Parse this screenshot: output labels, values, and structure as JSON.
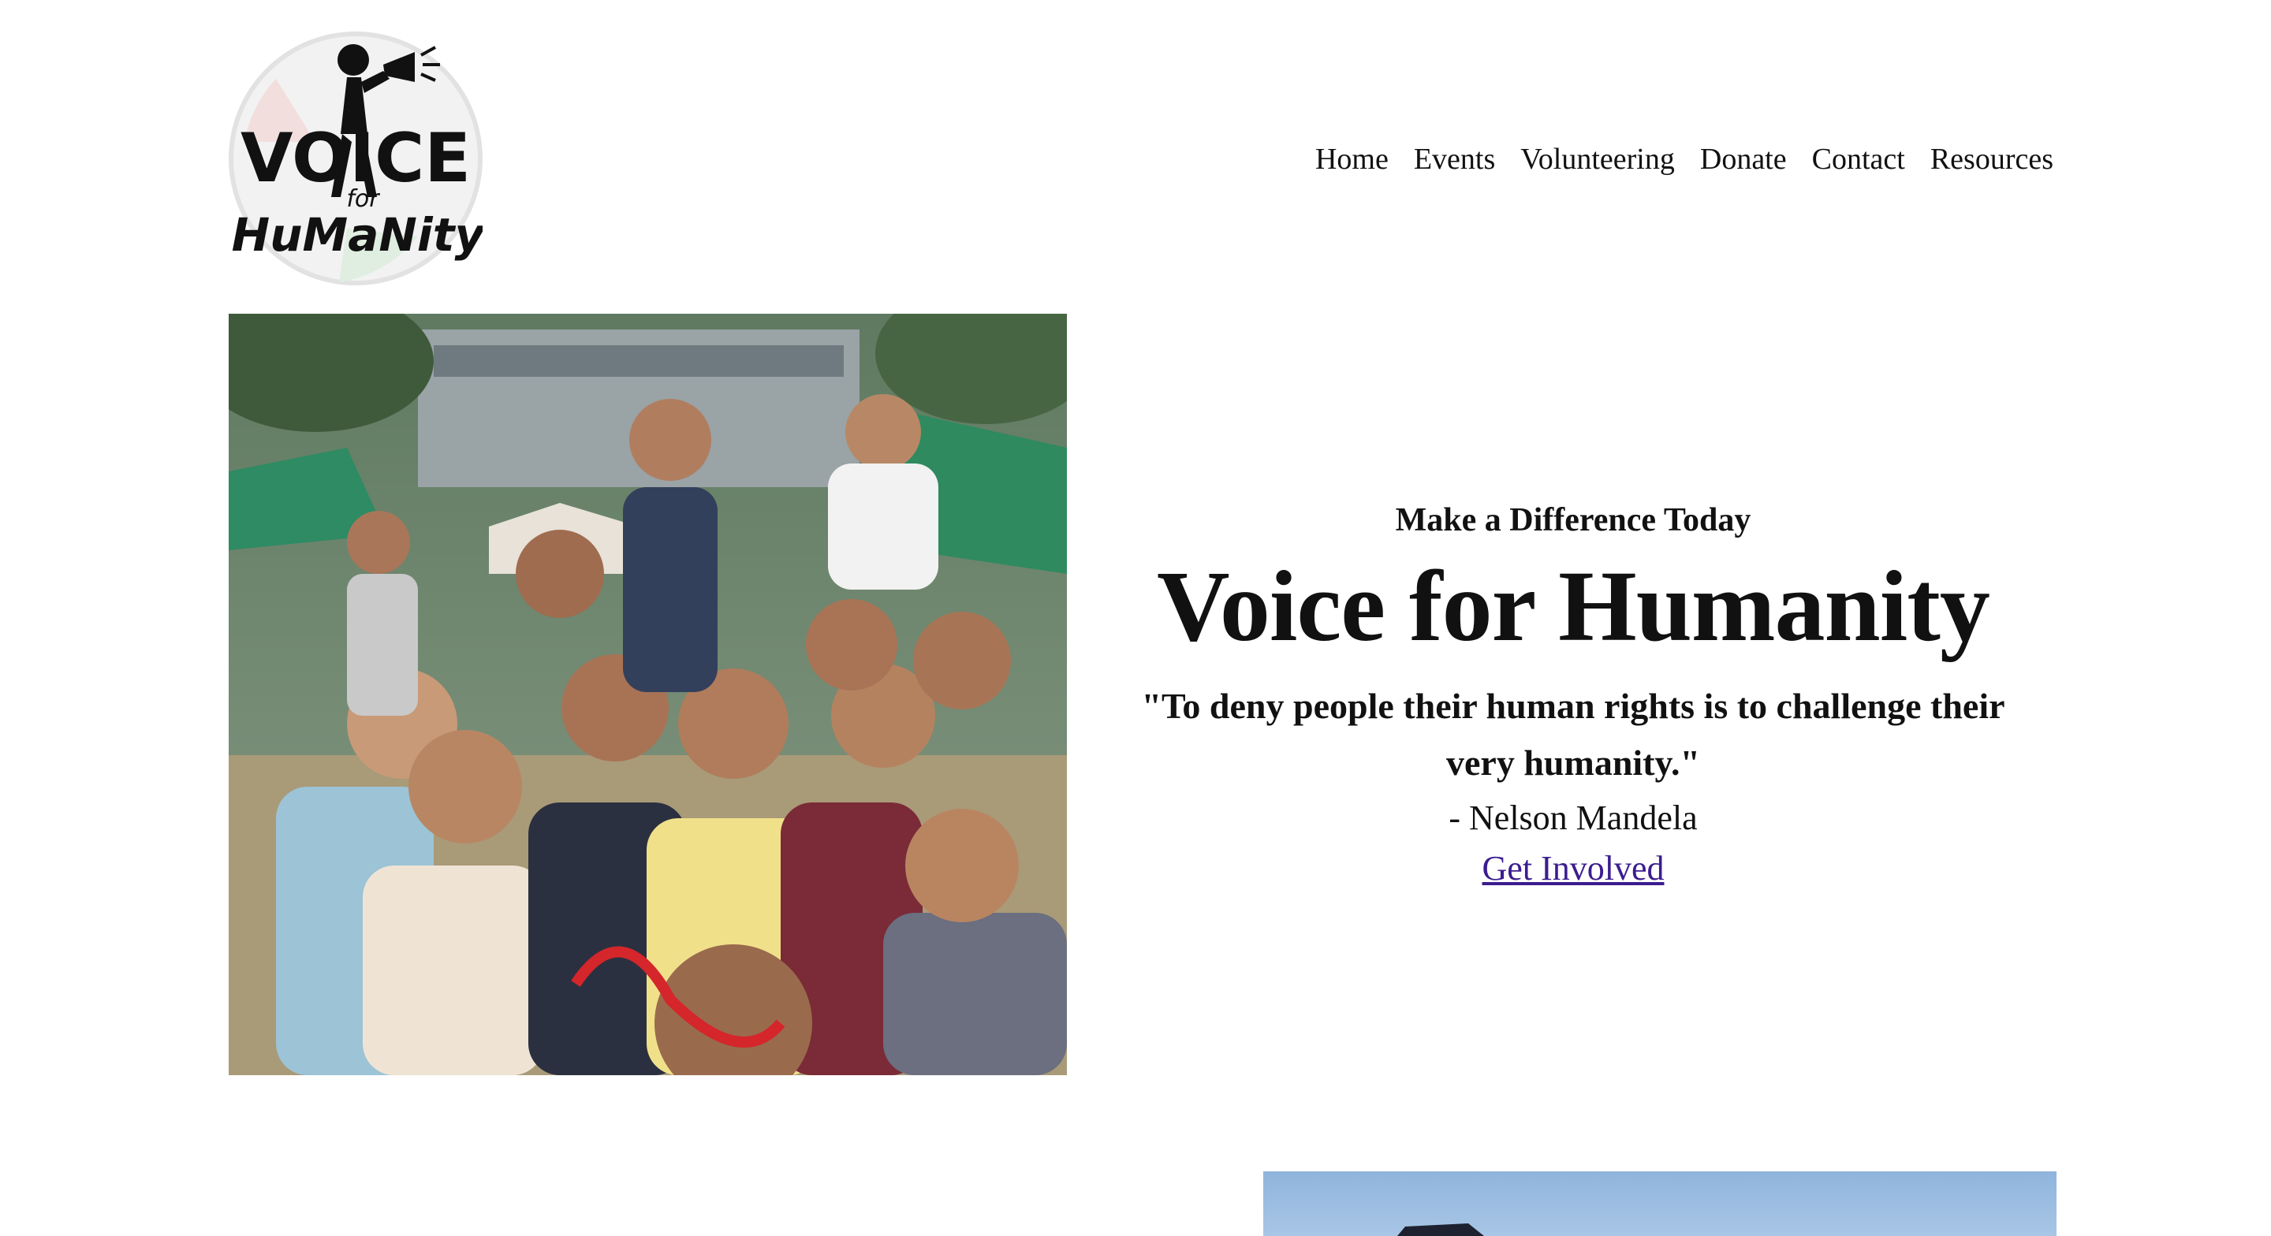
{
  "header": {
    "logo_alt": "Voice for Humanity logo",
    "logo_text": {
      "line1": "VOICE",
      "line2": "for",
      "line3": "HuMaNity"
    },
    "nav": [
      "Home",
      "Events",
      "Volunteering",
      "Donate",
      "Contact",
      "Resources"
    ]
  },
  "hero": {
    "eyebrow": "Make a Difference Today",
    "title": "Voice for Humanity",
    "quote": "\"To deny people their human rights is to challenge their very humanity.\"",
    "attribution": "- Nelson Mandela",
    "cta_label": "Get Involved",
    "photo_alt": "Group of smiling children making peace signs"
  },
  "colors": {
    "link": "#3b1d8f",
    "text": "#111111",
    "background": "#ffffff"
  }
}
